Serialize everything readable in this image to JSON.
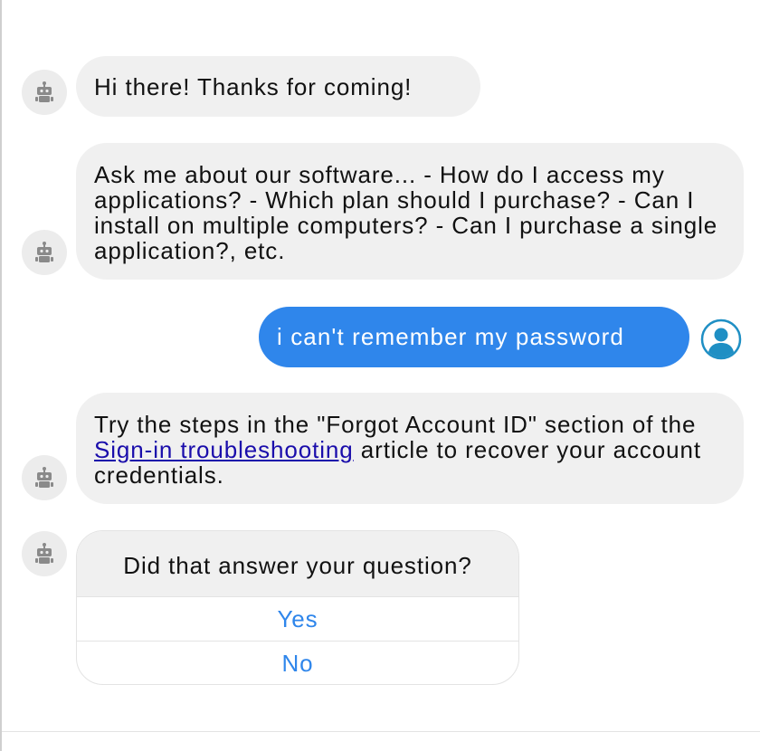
{
  "messages": {
    "greeting": "Hi there! Thanks for coming!",
    "intro": "Ask me about our software... - How do I access my applications? - Which plan should I purchase? - Can I install on multiple computers? - Can I purchase a single application?, etc.",
    "user": "i can't remember my password",
    "answer": {
      "before": "Try the steps in the \"Forgot Account ID\" section of the ",
      "link": "Sign-in troubleshooting",
      "after": " article to recover your account credentials."
    }
  },
  "feedback": {
    "question": "Did that answer your question?",
    "yes": "Yes",
    "no": "No"
  },
  "icons": {
    "bot": "robot-icon",
    "user": "user-avatar-icon"
  },
  "colors": {
    "user_bubble": "#2f86eb",
    "bot_bubble": "#f0f0f0",
    "link": "#1a0dab",
    "option_text": "#2f86eb"
  }
}
